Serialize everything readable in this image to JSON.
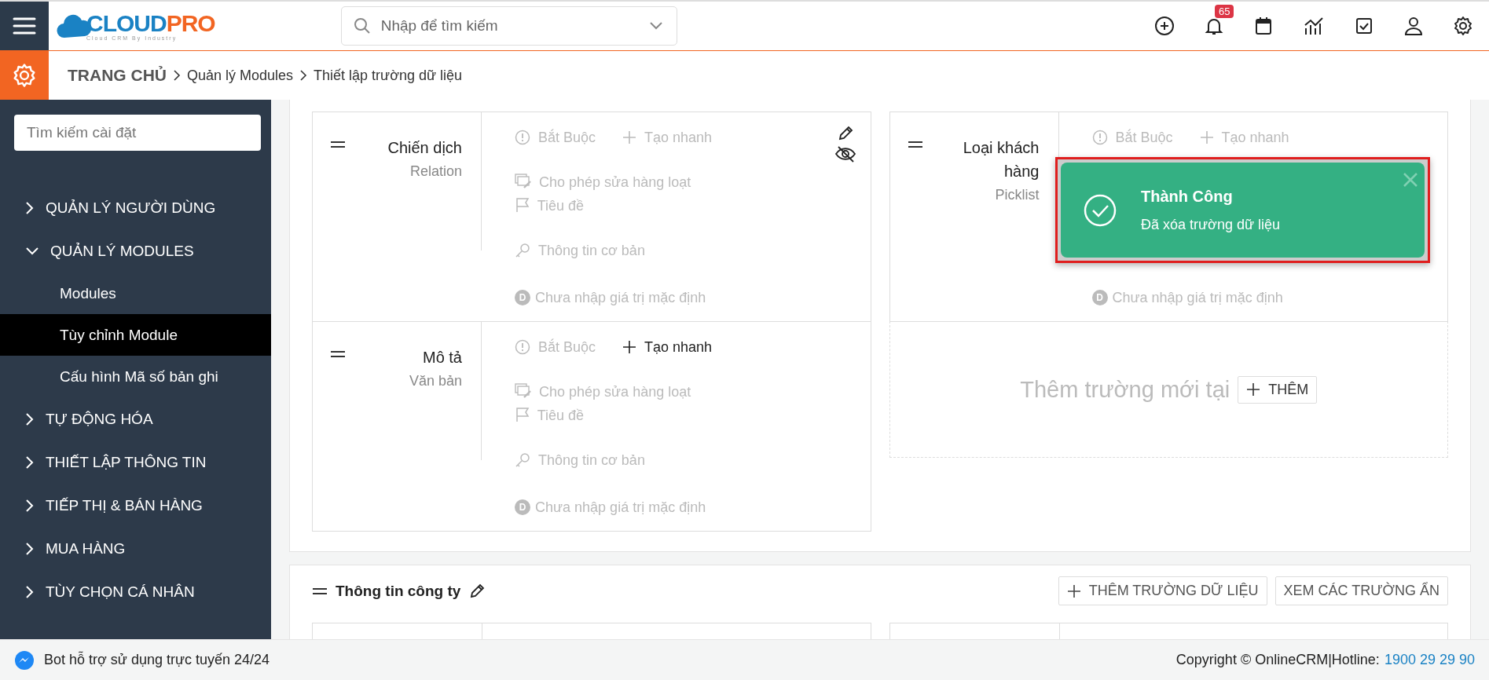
{
  "topbar": {
    "logo": {
      "part_1": "CLOUD",
      "part_2": "PRO",
      "tagline": "Cloud CRM By Industry"
    },
    "search": {
      "placeholder": "Nhập để tìm kiếm"
    },
    "notification_count": "65"
  },
  "breadcrumb": [
    {
      "label": "TRANG CHỦ",
      "kind": "home"
    },
    {
      "label": "Quản lý Modules",
      "kind": "link"
    },
    {
      "label": "Thiết lập trường dữ liệu",
      "kind": "current"
    }
  ],
  "sidebar": {
    "search": {
      "placeholder": "Tìm kiếm cài đặt"
    },
    "items": [
      {
        "label": "QUẢN LÝ NGƯỜI DÙNG",
        "expanded": false
      },
      {
        "label": "QUẢN LÝ MODULES",
        "expanded": true,
        "children": [
          {
            "label": "Modules",
            "selected": false
          },
          {
            "label": "Tùy chỉnh Module",
            "selected": true
          },
          {
            "label": "Cấu hình Mã số bản ghi",
            "selected": false
          }
        ]
      },
      {
        "label": "TỰ ĐỘNG HÓA",
        "expanded": false
      },
      {
        "label": "THIẾT LẬP THÔNG TIN",
        "expanded": false
      },
      {
        "label": "TIẾP THỊ & BÁN HÀNG",
        "expanded": false
      },
      {
        "label": "MUA HÀNG",
        "expanded": false
      },
      {
        "label": "TÙY CHỌN CÁ NHÂN",
        "expanded": false
      }
    ]
  },
  "field_columns": [
    [
      {
        "name": "Chiến dịch",
        "type": "Relation",
        "show_actions": true,
        "option_rows": [
          [
            {
              "kind": "required",
              "label": "Bắt Buộc",
              "active": false
            },
            {
              "kind": "quick_create",
              "label": "Tạo nhanh",
              "active": false
            }
          ],
          [
            {
              "kind": "mass_edit",
              "label": "Cho phép sửa hàng loạt",
              "active": false
            },
            {
              "kind": "header_field",
              "label": "Tiêu đề",
              "active": false
            }
          ],
          [
            {
              "kind": "key_field",
              "label": "Thông tin cơ bản",
              "active": false
            }
          ],
          [
            {
              "kind": "default_value",
              "label": "Chưa nhập giá trị mặc định",
              "badge": "D",
              "active": false
            }
          ]
        ]
      },
      {
        "name": "Mô tả",
        "type": "Văn bản",
        "show_actions": false,
        "option_rows": [
          [
            {
              "kind": "required",
              "label": "Bắt Buộc",
              "active": false
            },
            {
              "kind": "quick_create",
              "label": "Tạo nhanh",
              "active": true
            }
          ],
          [
            {
              "kind": "mass_edit",
              "label": "Cho phép sửa hàng loạt",
              "active": false
            },
            {
              "kind": "header_field",
              "label": "Tiêu đề",
              "active": false
            }
          ],
          [
            {
              "kind": "key_field",
              "label": "Thông tin cơ bản",
              "active": false
            }
          ],
          [
            {
              "kind": "default_value",
              "label": "Chưa nhập giá trị mặc định",
              "badge": "D",
              "active": false
            }
          ]
        ]
      }
    ],
    [
      {
        "name": "Loại khách hàng",
        "type": "Picklist",
        "show_actions": false,
        "option_rows": [
          [
            {
              "kind": "required",
              "label": "Bắt Buộc",
              "active": false
            },
            {
              "kind": "quick_create",
              "label": "Tạo nhanh",
              "active": false
            }
          ],
          [
            {
              "kind": "default_value",
              "label": "Chưa nhập giá trị mặc định",
              "badge": "D",
              "active": false
            }
          ]
        ]
      }
    ]
  ],
  "add_slot": {
    "text": "Thêm trường mới tại",
    "button": "THÊM"
  },
  "block_2": {
    "title": "Thông tin công ty",
    "buttons": [
      {
        "kind": "add",
        "label": "THÊM TRƯỜNG DỮ LIỆU"
      },
      {
        "kind": "plain",
        "label": "XEM CÁC TRƯỜNG ẨN"
      }
    ]
  },
  "toast": {
    "title": "Thành Công",
    "message": "Đã xóa trường dữ liệu"
  },
  "footer": {
    "bot": "Bot hỗ trợ sử dụng trực tuyến 24/24",
    "copyright": "Copyright © OnlineCRM|Hotline:",
    "hotline": "1900 29 29 90"
  }
}
